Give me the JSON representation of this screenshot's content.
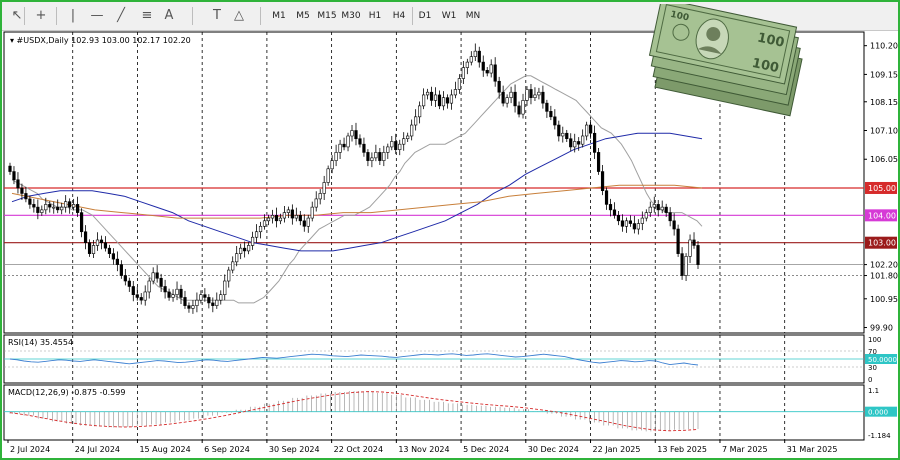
{
  "toolbar": {
    "icons": [
      "cursor-icon",
      "crosshair-icon",
      "vertical-line-icon",
      "horizontal-line-icon",
      "trendline-icon",
      "fibonacci-icon",
      "text-icon",
      "text-label-icon",
      "shapes-icon"
    ],
    "timeframes": [
      "M1",
      "M5",
      "M15",
      "M30",
      "H1",
      "H4",
      "D1",
      "W1",
      "MN"
    ]
  },
  "chart_data": {
    "type": "candlestick",
    "title": "#USDX,Daily",
    "ohlc_header": "102.93 103.00 102.17 102.20",
    "price_scale": [
      110.2,
      109.15,
      108.15,
      107.1,
      106.05,
      105.0,
      104.0,
      103.0,
      102.2,
      101.8,
      100.95,
      99.9
    ],
    "ylim": [
      99.7,
      110.7
    ],
    "x_labels": [
      "2 Jul 2024",
      "24 Jul 2024",
      "15 Aug 2024",
      "6 Sep 2024",
      "30 Sep 2024",
      "22 Oct 2024",
      "13 Nov 2024",
      "5 Dec 2024",
      "30 Dec 2024",
      "22 Jan 2025",
      "13 Feb 2025",
      "7 Mar 2025",
      "31 Mar 2025"
    ],
    "closes": [
      105.6,
      105.3,
      105.0,
      104.8,
      104.6,
      104.4,
      104.3,
      104.1,
      104.2,
      104.4,
      104.3,
      104.3,
      104.2,
      104.3,
      104.5,
      104.3,
      104.4,
      104.1,
      103.4,
      103.0,
      102.6,
      102.9,
      103.1,
      103.0,
      102.8,
      102.6,
      102.4,
      102.2,
      101.8,
      101.6,
      101.4,
      101.1,
      101.0,
      100.9,
      101.2,
      101.6,
      101.9,
      101.7,
      101.4,
      101.2,
      101.0,
      101.1,
      101.3,
      101.0,
      100.7,
      100.6,
      100.7,
      100.9,
      101.1,
      101.0,
      100.8,
      100.7,
      100.9,
      101.1,
      101.6,
      102.0,
      102.3,
      102.6,
      102.8,
      102.7,
      102.9,
      103.2,
      103.4,
      103.6,
      103.8,
      103.9,
      104.0,
      103.8,
      103.9,
      104.1,
      104.2,
      103.9,
      104.0,
      103.8,
      103.6,
      103.9,
      104.3,
      104.6,
      104.8,
      105.2,
      105.7,
      106.0,
      106.3,
      106.6,
      106.5,
      106.9,
      107.1,
      106.8,
      106.6,
      106.3,
      106.0,
      106.1,
      106.3,
      106.0,
      106.3,
      106.5,
      106.7,
      106.4,
      106.6,
      106.8,
      106.9,
      107.3,
      107.6,
      108.0,
      108.4,
      108.5,
      108.2,
      108.4,
      108.0,
      108.3,
      108.1,
      108.4,
      108.6,
      109.0,
      109.4,
      109.6,
      109.8,
      110.0,
      109.6,
      109.3,
      109.2,
      109.5,
      108.9,
      108.5,
      108.1,
      108.3,
      108.5,
      108.0,
      107.7,
      108.2,
      108.6,
      108.3,
      108.4,
      108.5,
      108.1,
      107.8,
      107.6,
      107.3,
      106.9,
      107.0,
      106.8,
      106.5,
      106.7,
      106.6,
      106.9,
      107.3,
      107.0,
      106.3,
      105.6,
      104.9,
      104.4,
      104.2,
      104.0,
      103.8,
      103.6,
      103.8,
      103.7,
      103.5,
      103.7,
      103.9,
      104.1,
      104.3,
      104.4,
      104.2,
      104.3,
      104.1,
      103.8,
      103.5,
      102.6,
      101.8,
      102.5,
      103.1,
      102.9,
      102.2
    ],
    "moving_averages": [
      {
        "name": "MA short",
        "color": "#a0a0a0",
        "values": [
          105.3,
          105.2,
          105.1,
          105.0,
          104.9,
          104.8,
          104.6,
          104.5,
          104.4,
          104.3,
          104.3,
          104.3,
          104.2,
          104.2,
          104.2,
          104.1,
          104.0,
          103.8,
          103.6,
          103.4,
          103.2,
          103.0,
          102.8,
          102.6,
          102.4,
          102.2,
          102.0,
          101.8,
          101.6,
          101.4,
          101.3,
          101.2,
          101.1,
          101.0,
          100.9,
          100.9,
          100.9,
          100.9,
          100.9,
          100.9,
          100.9,
          100.9,
          100.9,
          100.9,
          100.9,
          100.8,
          100.8,
          100.8,
          100.8,
          100.9,
          101.0,
          101.2,
          101.4,
          101.6,
          101.9,
          102.2,
          102.4,
          102.7,
          102.9,
          103.1,
          103.3,
          103.5,
          103.6,
          103.7,
          103.8,
          103.9,
          104.0,
          104.0,
          104.0,
          104.1,
          104.2,
          104.3,
          104.5,
          104.7,
          104.9,
          105.1,
          105.4,
          105.6,
          105.9,
          106.1,
          106.3,
          106.4,
          106.5,
          106.6,
          106.6,
          106.6,
          106.6,
          106.7,
          106.8,
          106.9,
          107.0,
          107.2,
          107.4,
          107.6,
          107.8,
          108.0,
          108.2,
          108.4,
          108.6,
          108.8,
          108.9,
          109.0,
          109.1,
          109.1,
          109.0,
          108.9,
          108.8,
          108.7,
          108.6,
          108.5,
          108.4,
          108.3,
          108.2,
          108.0,
          107.8,
          107.6,
          107.4,
          107.2,
          107.1,
          107.0,
          106.8,
          106.6,
          106.3,
          106.0,
          105.6,
          105.2,
          104.8,
          104.5,
          104.3,
          104.2,
          104.1,
          104.1,
          104.1,
          104.1,
          104.0,
          103.9,
          103.8,
          103.6
        ]
      },
      {
        "name": "MA medium",
        "color": "#1f2aa8",
        "values": [
          104.5,
          104.7,
          104.8,
          104.9,
          104.9,
          104.9,
          104.8,
          104.7,
          104.5,
          104.3,
          104.1,
          103.8,
          103.6,
          103.4,
          103.2,
          103.0,
          102.9,
          102.8,
          102.7,
          102.7,
          102.7,
          102.8,
          102.9,
          103.0,
          103.2,
          103.4,
          103.6,
          103.8,
          104.1,
          104.4,
          104.8,
          105.1,
          105.5,
          105.8,
          106.1,
          106.4,
          106.6,
          106.8,
          106.9,
          107.0,
          107.0,
          107.0,
          106.9,
          106.8
        ]
      },
      {
        "name": "MA long",
        "color": "#c87f3a",
        "values": [
          104.8,
          104.6,
          104.4,
          104.2,
          104.1,
          104.0,
          103.9,
          103.9,
          103.9,
          103.9,
          104.0,
          104.0,
          104.1,
          104.1,
          104.2,
          104.3,
          104.4,
          104.5,
          104.7,
          104.8,
          104.9,
          105.0,
          105.1,
          105.1,
          105.1,
          105.0
        ]
      }
    ],
    "horizontal_levels": [
      {
        "value": 105.0,
        "label": "105.00",
        "color": "#d62b2b"
      },
      {
        "value": 104.0,
        "label": "104.00",
        "color": "#d63ad6"
      },
      {
        "value": 103.0,
        "label": "103.00",
        "color": "#9b1b1b"
      }
    ],
    "rsi": {
      "label": "RSI(14) 35.4554",
      "scale": [
        "100",
        "70",
        "50.0000",
        "30",
        "0"
      ],
      "level_line": 50,
      "last_value": 35.4554,
      "values": [
        50,
        48,
        45,
        43,
        42,
        44,
        46,
        48,
        47,
        45,
        44,
        46,
        48,
        46,
        44,
        42,
        40,
        38,
        40,
        42,
        44,
        46,
        45,
        43,
        41,
        42,
        44,
        46,
        48,
        47,
        45,
        44,
        46,
        48,
        50,
        52,
        54,
        53,
        52,
        54,
        56,
        58,
        60,
        62,
        61,
        60,
        58,
        57,
        56,
        58,
        60,
        59,
        58,
        57,
        55,
        54,
        56,
        58,
        60,
        62,
        61,
        60,
        62,
        63,
        61,
        59,
        60,
        62,
        63,
        61,
        59,
        57,
        55,
        56,
        58,
        60,
        62,
        60,
        58,
        56,
        52,
        48,
        45,
        42,
        40,
        42,
        44,
        46,
        45,
        43,
        44,
        46,
        45,
        40,
        36,
        38,
        40,
        37,
        35
      ]
    },
    "macd": {
      "label": "MACD(12,26,9) -0.875 -0.599",
      "scale": [
        "1.1",
        "0.000",
        "-1.184"
      ],
      "ylim": [
        -1.184,
        1.1
      ],
      "histogram": [
        -0.1,
        -0.2,
        -0.35,
        -0.5,
        -0.6,
        -0.7,
        -0.75,
        -0.8,
        -0.78,
        -0.72,
        -0.65,
        -0.55,
        -0.45,
        -0.35,
        -0.2,
        -0.05,
        0.1,
        0.25,
        0.4,
        0.55,
        0.7,
        0.82,
        0.92,
        1.0,
        1.05,
        1.02,
        0.95,
        0.85,
        0.72,
        0.6,
        0.5,
        0.42,
        0.35,
        0.3,
        0.25,
        0.2,
        0.12,
        0.02,
        -0.1,
        -0.25,
        -0.4,
        -0.55,
        -0.7,
        -0.85,
        -0.95,
        -1.0,
        -0.98,
        -0.92,
        -0.88
      ],
      "signal": [
        -0.05,
        -0.15,
        -0.28,
        -0.42,
        -0.54,
        -0.64,
        -0.71,
        -0.76,
        -0.78,
        -0.76,
        -0.71,
        -0.64,
        -0.55,
        -0.45,
        -0.33,
        -0.2,
        -0.05,
        0.1,
        0.25,
        0.4,
        0.55,
        0.68,
        0.8,
        0.9,
        0.98,
        1.02,
        1.0,
        0.93,
        0.83,
        0.72,
        0.62,
        0.53,
        0.45,
        0.38,
        0.32,
        0.26,
        0.19,
        0.1,
        0.0,
        -0.13,
        -0.27,
        -0.42,
        -0.57,
        -0.72,
        -0.84,
        -0.93,
        -0.97,
        -0.95,
        -0.9
      ]
    }
  },
  "image_caption_logo": "money-stack-image"
}
